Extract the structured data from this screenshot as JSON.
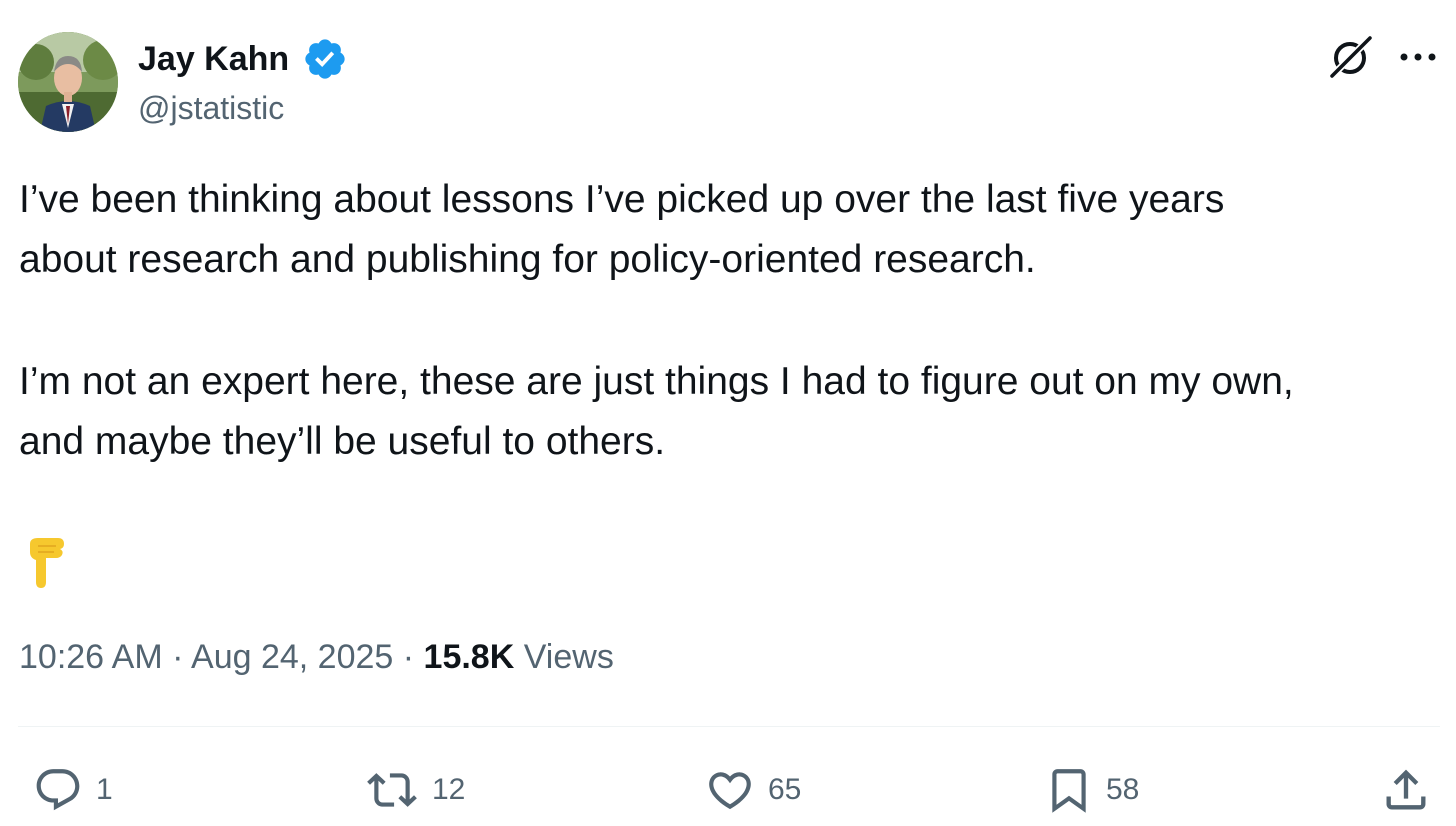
{
  "author": {
    "name": "Jay Kahn",
    "handle": "@jstatistic",
    "verified": true,
    "badge_color": "#1d9bf0"
  },
  "header_icons": [
    "grok-icon",
    "more-icon"
  ],
  "tweet": {
    "lines": [
      "I’ve been thinking about lessons I’ve picked up over the last five years",
      "about research and publishing for policy-oriented research.",
      "I’m not an expert here, these are just things I had to figure out on my own,",
      "and maybe they’ll be useful to others."
    ],
    "emoji": "backhand-index-pointing-down"
  },
  "meta": {
    "time": "10:26 AM",
    "separator": "·",
    "date": "Aug 24, 2025",
    "views_count": "15.8K",
    "views_label": "Views"
  },
  "actions": {
    "reply": "1",
    "repost": "12",
    "like": "65",
    "bookmark": "58"
  },
  "colors": {
    "text": "#0f1419",
    "secondary": "#536471",
    "accent": "#1d9bf0",
    "divider": "#eff3f4",
    "emoji": "#f6c82e"
  }
}
